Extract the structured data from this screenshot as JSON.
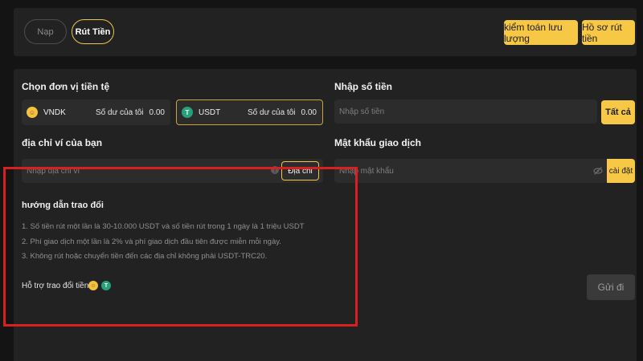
{
  "tabs": [
    {
      "label": "Nạp",
      "active": false
    },
    {
      "label": "Rút Tiền",
      "active": true
    }
  ],
  "header_buttons": {
    "audit": "kiểm toán lưu lượng",
    "history": "Hồ sơ rút tiền"
  },
  "currency_section": {
    "label": "Chọn đơn vị tiền tệ",
    "options": [
      {
        "name": "VNDK",
        "balance_label": "Số dư của tôi",
        "balance": "0.00",
        "icon": "vndk-coin-icon",
        "selected": false
      },
      {
        "name": "USDT",
        "balance_label": "Số dư của tôi",
        "balance": "0.00",
        "icon": "tether-icon",
        "selected": true
      }
    ]
  },
  "amount": {
    "label": "Nhập số tiền",
    "placeholder": "Nhập số tiền",
    "all_button": "Tất cả"
  },
  "wallet": {
    "label": "địa chỉ ví của bạn",
    "placeholder": "Nhập địa chỉ ví",
    "address_button": "Địa chỉ"
  },
  "password": {
    "label": "Mật khẩu giao dịch",
    "placeholder": "Nhập mật khẩu",
    "set_button": "cài đặt"
  },
  "guide": {
    "title": "hướng dẫn trao đổi",
    "lines": [
      "1. Số tiền rút một lần là 30-10.000 USDT và số tiền rút trong 1 ngày là 1 triệu USDT",
      "2. Phí giao dịch một lần là 2% và phí giao dịch đầu tiên được miễn mỗi ngày.",
      "3. Không rút hoặc chuyển tiền đến các địa chỉ không phải USDT-TRC20."
    ],
    "support_label": "Hỗ trợ trao đổi tiền tệ"
  },
  "send_button": "Gửi đi",
  "colors": {
    "accent": "#f7c845",
    "background": "#141414",
    "panel": "#222222",
    "highlight": "#d82021",
    "tether": "#26a17b"
  }
}
